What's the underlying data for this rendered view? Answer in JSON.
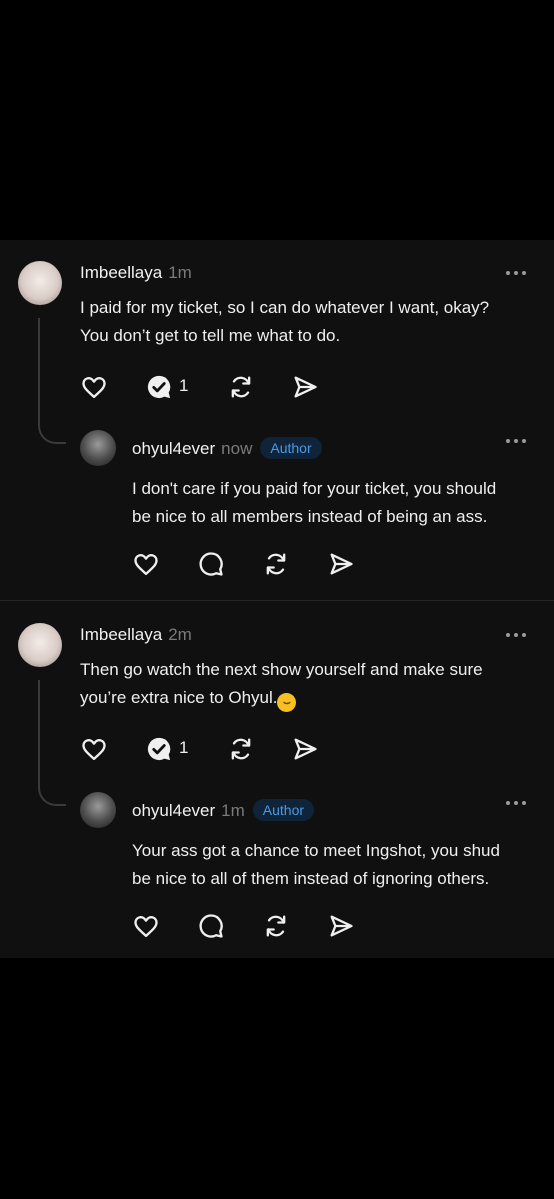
{
  "comments": [
    {
      "author": "Imbeellaya",
      "time": "1m",
      "text_line1": "I paid for my ticket, so I can do whatever I want, okay?",
      "text_line2": "You don’t get to tell me what to do.",
      "reply_count": "1",
      "reply": {
        "author": "ohyul4ever",
        "time": "now",
        "badge": "Author",
        "text_line1": "I don't care if you paid for your ticket, you should",
        "text_line2": "be nice to all members instead of being an ass."
      }
    },
    {
      "author": "Imbeellaya",
      "time": "2m",
      "text_line1": "Then go watch the next show yourself and make sure",
      "text_line2": "you’re extra nice to Ohyul.",
      "emoji": "laughing-emoji",
      "reply_count": "1",
      "reply": {
        "author": "ohyul4ever",
        "time": "1m",
        "badge": "Author",
        "text_line1": "Your ass got a chance to meet Ingshot, you shud",
        "text_line2": "be nice to all of them instead of ignoring others."
      }
    }
  ],
  "colors": {
    "background": "#101010",
    "badge_text": "#4a9ae6",
    "badge_bg": "#0f2438"
  }
}
